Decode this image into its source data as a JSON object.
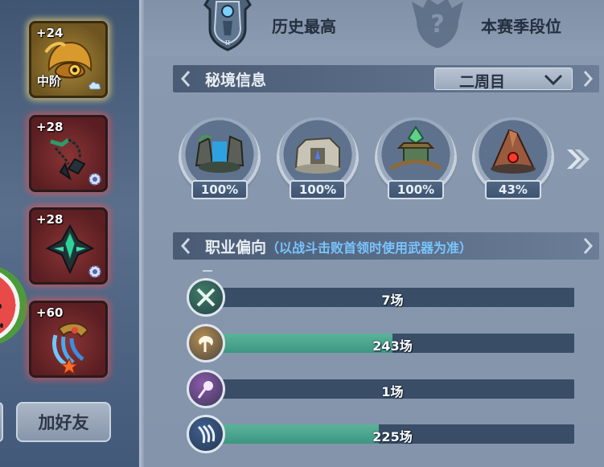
{
  "equipment": [
    {
      "level": "+24",
      "tag": "中阶",
      "rarity": "gold",
      "icon": "demon-helmet-icon"
    },
    {
      "level": "+28",
      "rarity": "red",
      "icon": "chain-flail-icon"
    },
    {
      "level": "+28",
      "rarity": "red",
      "icon": "crystal-staff-icon"
    },
    {
      "level": "+60",
      "rarity": "red",
      "icon": "ice-claw-icon"
    }
  ],
  "actions": {
    "add_friend": "加好友"
  },
  "ranks": {
    "history_best": "历史最高",
    "season_rank": "本赛季段位"
  },
  "secret_realm": {
    "title": "秘境信息",
    "week_select": "二周目",
    "dungeons": [
      {
        "icon": "waterfall-ruins-icon",
        "progress": "100%"
      },
      {
        "icon": "stone-shrine-icon",
        "progress": "100%"
      },
      {
        "icon": "jade-pagoda-icon",
        "progress": "100%"
      },
      {
        "icon": "volcano-rock-icon",
        "progress": "43%"
      }
    ]
  },
  "class_preference": {
    "title": "职业偏向",
    "subtitle": "（以战斗击败首领时使用武器为准）",
    "classes": [
      {
        "icon": "crossed-swords-icon",
        "count": "7场",
        "matches": 7,
        "color": "#3f7d68"
      },
      {
        "icon": "axe-icon",
        "count": "243场",
        "matches": 243,
        "color": "#b58d52"
      },
      {
        "icon": "magic-staff-icon",
        "count": "1场",
        "matches": 1,
        "color": "#8a5aa8"
      },
      {
        "icon": "claw-icon",
        "count": "225场",
        "matches": 225,
        "color": "#3e5f8e"
      }
    ],
    "max_matches": 486
  },
  "colors": {
    "accent_fill": "#4aa78e",
    "subtitle_blue": "#79c5ff",
    "header_bar": "#4a5b74"
  }
}
